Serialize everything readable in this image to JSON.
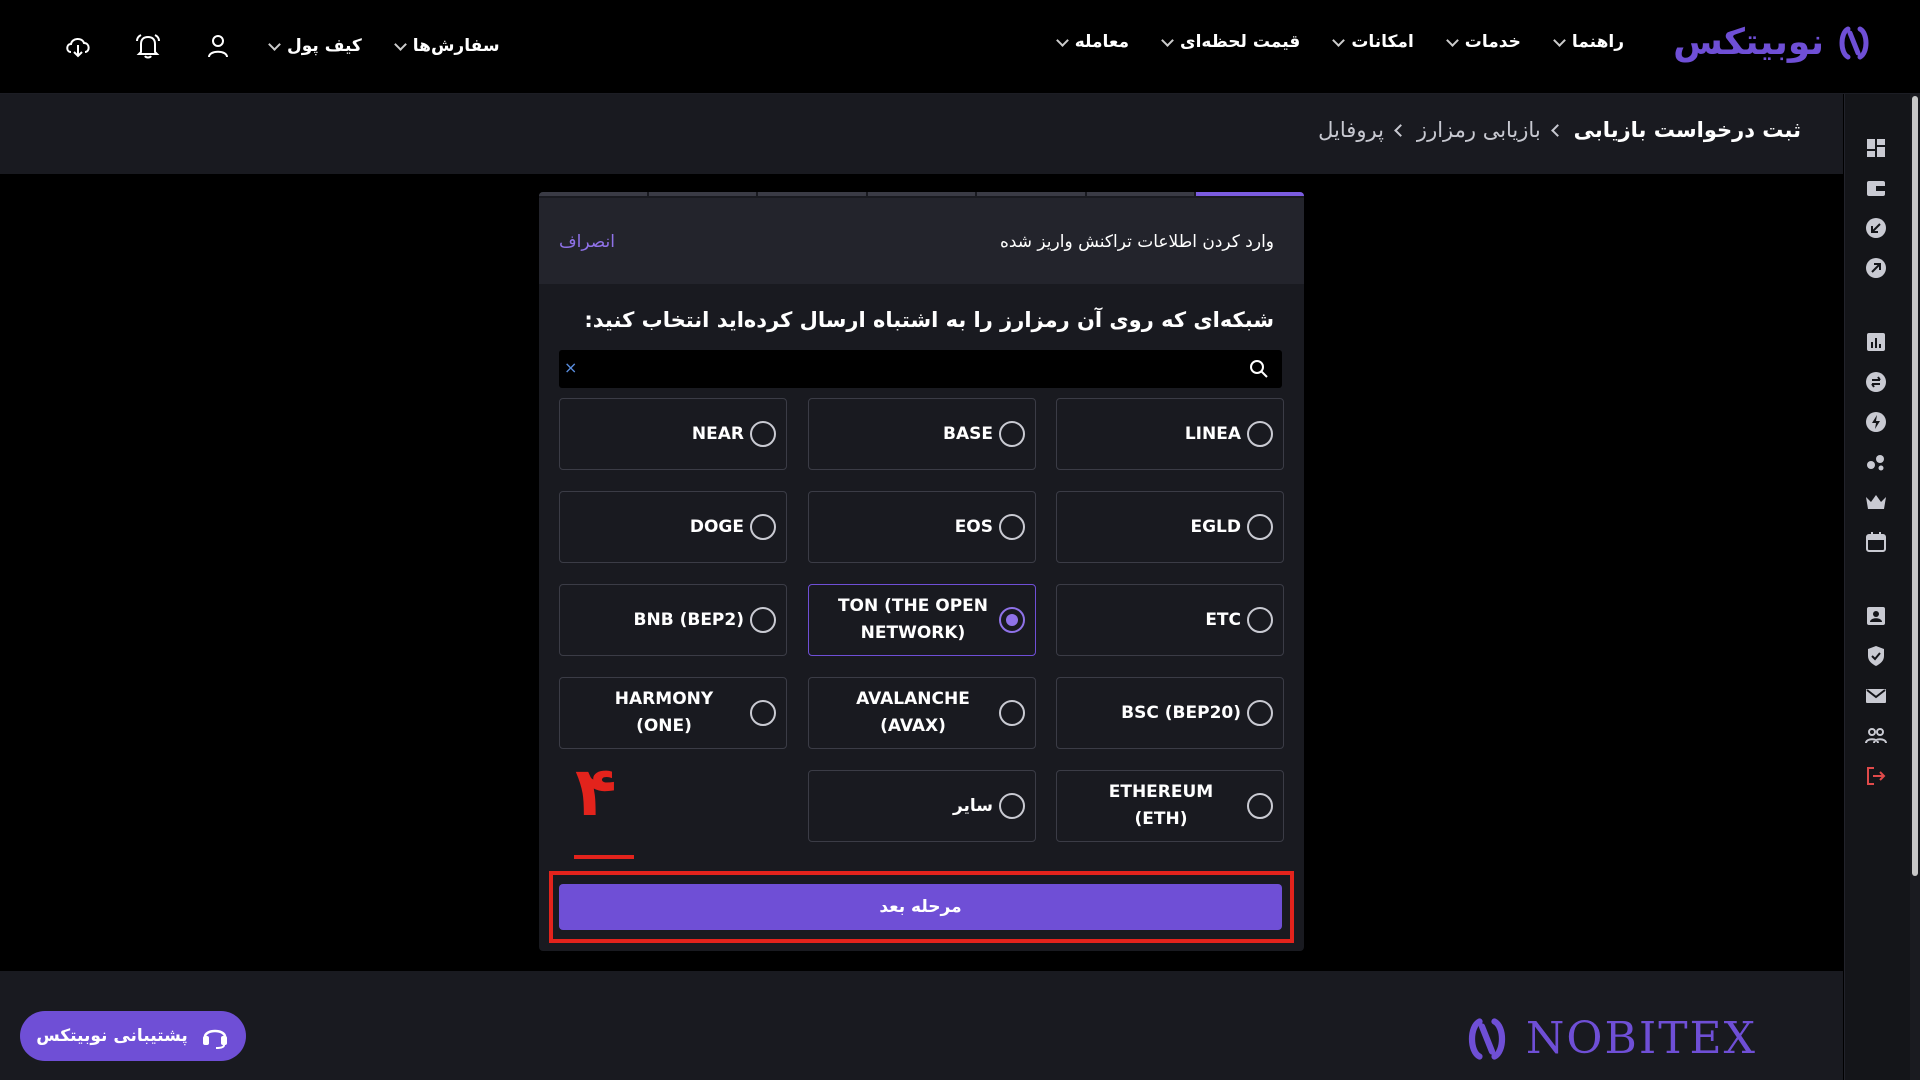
{
  "brand": {
    "name_fa": "نوبیتکس",
    "name_en": "NOBITEX",
    "color": "#6f4fd6"
  },
  "nav": {
    "items": [
      {
        "label": "معامله",
        "name": "nav-trade"
      },
      {
        "label": "قیمت لحظه‌ای",
        "name": "nav-live-price"
      },
      {
        "label": "امکانات",
        "name": "nav-features"
      },
      {
        "label": "خدمات",
        "name": "nav-services"
      },
      {
        "label": "راهنما",
        "name": "nav-help"
      }
    ],
    "orders_label": "سفارش‌ها",
    "wallet_label": "کیف پول"
  },
  "breadcrumb": {
    "profile": "پروفایل",
    "recovery": "بازیابی رمزارز",
    "current": "ثبت درخواست بازیابی"
  },
  "modal": {
    "title": "وارد کردن اطلاعات تراکنش واریز شده",
    "cancel": "انصراف",
    "question": "شبکه‌ای که روی آن رمزارز را به اشتباه ارسال کرده‌اید انتخاب کنید:",
    "search_value": "",
    "clear_symbol": "×",
    "options": [
      {
        "label": "LINEA",
        "selected": false
      },
      {
        "label": "BASE",
        "selected": false
      },
      {
        "label": "NEAR",
        "selected": false
      },
      {
        "label": "EGLD",
        "selected": false
      },
      {
        "label": "EOS",
        "selected": false
      },
      {
        "label": "DOGE",
        "selected": false
      },
      {
        "label": "ETC",
        "selected": false
      },
      {
        "label": "TON (THE OPEN NETWORK)",
        "selected": true
      },
      {
        "label": "BNB (BEP2)",
        "selected": false
      },
      {
        "label": "BSC (BEP20)",
        "selected": false
      },
      {
        "label": "AVALANCHE (AVAX)",
        "selected": false
      },
      {
        "label": "HARMONY (ONE)",
        "selected": false
      },
      {
        "label": "ETHEREUM (ETH)",
        "selected": false
      },
      {
        "label": "سایر",
        "selected": false
      }
    ],
    "next_label": "مرحله بعد",
    "step_annotation": "۴"
  },
  "footer": {
    "support_label": "پشتیبانی نوبیتکس"
  },
  "colors": {
    "accent": "#6f4fd6",
    "annotation": "#e3231c",
    "panel": "#191a20"
  }
}
